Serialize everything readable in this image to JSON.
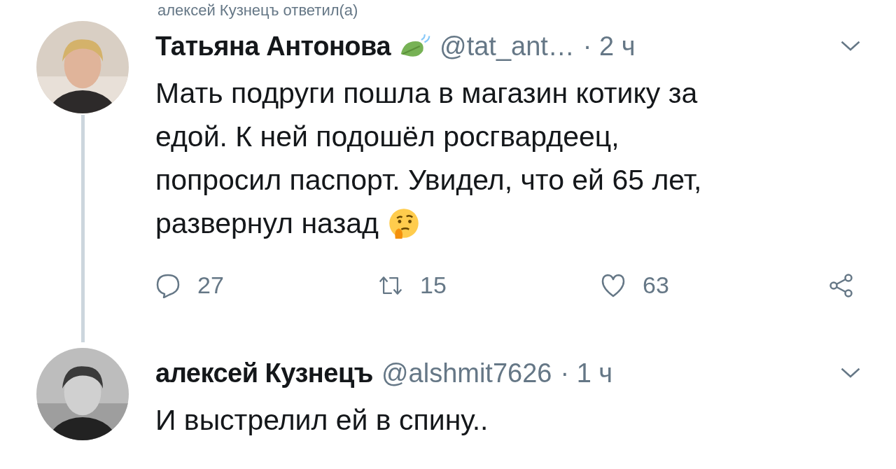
{
  "reply_context": "алексей Кузнецъ ответил(а)",
  "tweets": [
    {
      "name": "Татьяна Антонова",
      "leaf_badge": true,
      "handle": "@tat_ant…",
      "time": "· 2 ч",
      "lines": [
        "Мать подруги пошла в магазин котику за",
        "едой. К ней подошёл росгвардеец,",
        "попросил паспорт. Увидел, что ей 65 лет,",
        "развернул назад"
      ],
      "thinking_emoji": true,
      "thread_line": true,
      "actions": {
        "replies": "27",
        "retweets": "15",
        "likes": "63"
      }
    },
    {
      "name": "алексей Кузнецъ",
      "handle": "@alshmit7626",
      "time": "· 1 ч",
      "lines": [
        "И выстрелил ей в спину.."
      ]
    }
  ]
}
